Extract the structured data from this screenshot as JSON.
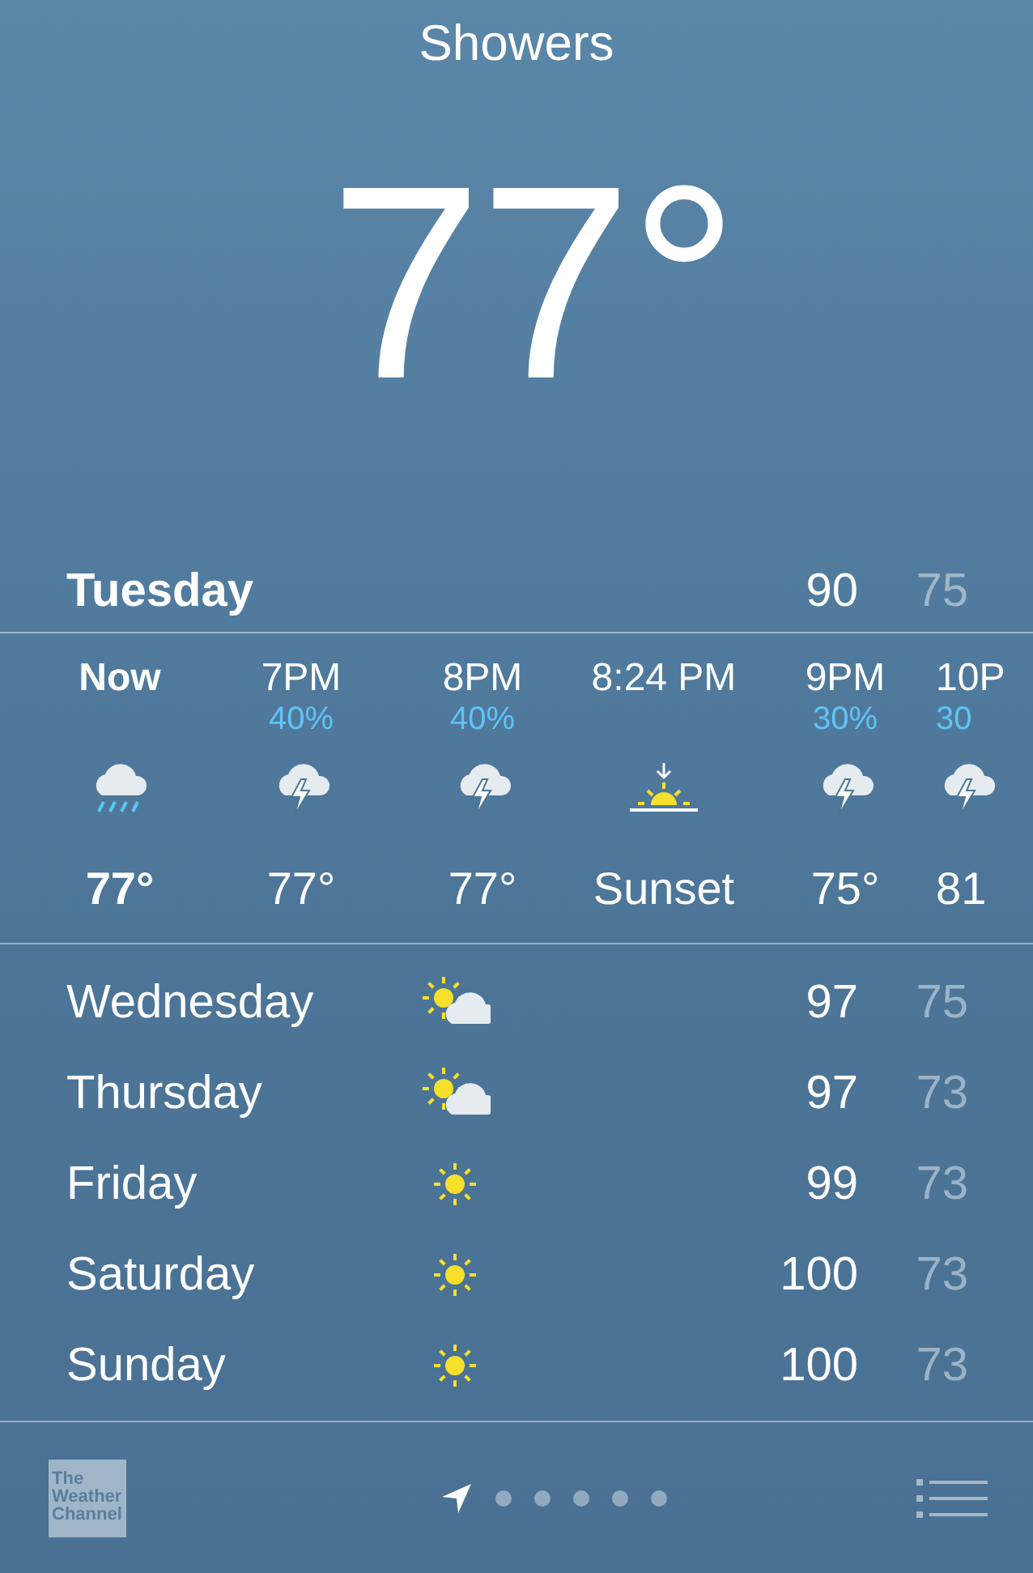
{
  "header": {
    "condition": "Showers",
    "temperature": "77°"
  },
  "today": {
    "day": "Tuesday",
    "high": "90",
    "low": "75"
  },
  "hourly": [
    {
      "time": "Now",
      "kind": "rain",
      "temp": "77°",
      "current": true
    },
    {
      "time": "7PM",
      "precip": "40%",
      "kind": "thunder",
      "temp": "77°",
      "current": false
    },
    {
      "time": "8PM",
      "precip": "40%",
      "kind": "thunder",
      "temp": "77°",
      "current": false
    },
    {
      "time": "8:24 PM",
      "kind": "sunset",
      "temp": "Sunset",
      "current": false
    },
    {
      "time": "9PM",
      "precip": "30%",
      "kind": "thunder",
      "temp": "75°",
      "current": false
    },
    {
      "time": "10P",
      "precip": "30",
      "kind": "thunder",
      "temp": "81",
      "current": false
    }
  ],
  "daily": [
    {
      "day": "Wednesday",
      "kind": "partly-sunny",
      "high": "97",
      "low": "75"
    },
    {
      "day": "Thursday",
      "kind": "partly-sunny",
      "high": "97",
      "low": "73"
    },
    {
      "day": "Friday",
      "kind": "sunny",
      "high": "99",
      "low": "73"
    },
    {
      "day": "Saturday",
      "kind": "sunny",
      "high": "100",
      "low": "73"
    },
    {
      "day": "Sunday",
      "kind": "sunny",
      "high": "100",
      "low": "73"
    }
  ],
  "footer": {
    "logo": [
      "The",
      "Weather",
      "Channel"
    ],
    "pages": [
      {
        "kind": "location",
        "selected": true
      },
      {
        "kind": "dot",
        "selected": false
      },
      {
        "kind": "dot",
        "selected": false
      },
      {
        "kind": "dot",
        "selected": false
      },
      {
        "kind": "dot",
        "selected": false
      },
      {
        "kind": "dot",
        "selected": false
      }
    ]
  }
}
